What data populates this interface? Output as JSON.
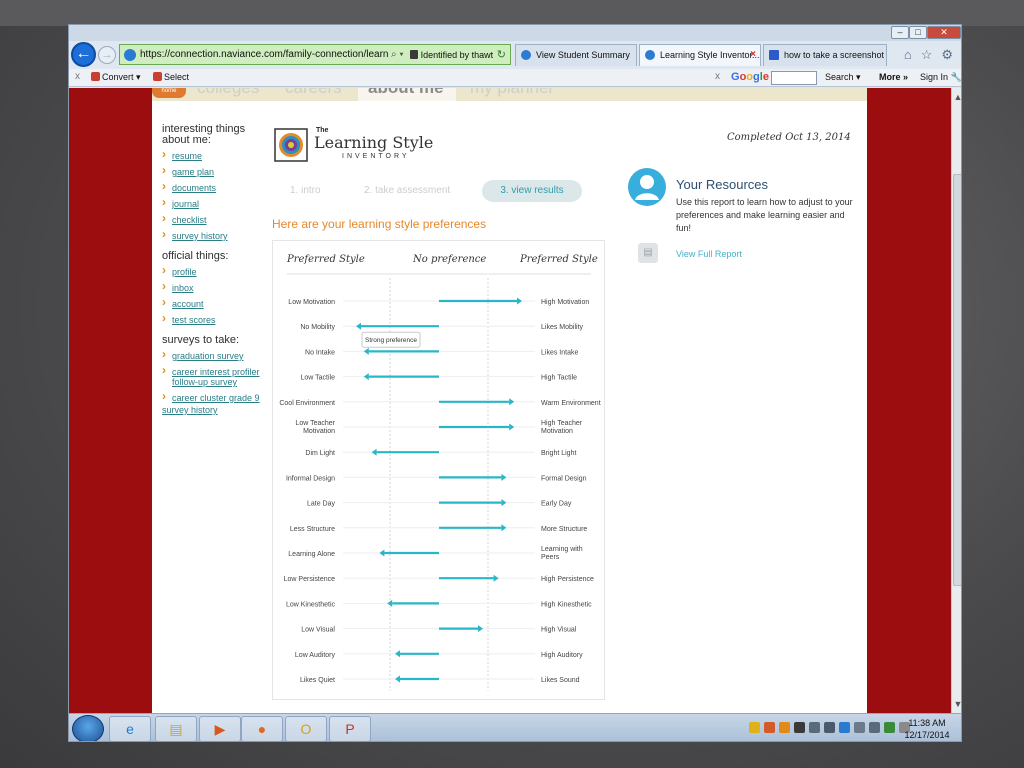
{
  "browser": {
    "address_url": "https://connection.naviance.com/family-connection/learning-styl",
    "address_tail": "⌕ ▾",
    "identified_text": "Identified by thawte",
    "tabs": [
      {
        "label": "View Student Summary"
      },
      {
        "label": "Learning Style Inventor..."
      },
      {
        "label": "how to take a screenshot -..."
      }
    ],
    "command_bar": {
      "convert_label": "Convert",
      "select_label": "Select",
      "google_logo": [
        "G",
        "o",
        "o",
        "g",
        "l",
        "e"
      ],
      "search_label": "Search",
      "more_label": "More »",
      "signin_label": "Sign In"
    }
  },
  "site_nav": {
    "home_label": "home",
    "tabs": [
      "colleges",
      "careers",
      "about me",
      "my planner"
    ]
  },
  "sidebar": {
    "sections": [
      {
        "heading": "interesting things about me:",
        "links": [
          "resume",
          "game plan",
          "documents",
          "journal",
          "checklist",
          "survey history"
        ]
      },
      {
        "heading": "official things:",
        "links": [
          "profile",
          "inbox",
          "account",
          "test scores"
        ]
      },
      {
        "heading": "surveys to take:",
        "links": [
          "graduation survey",
          "career interest profiler follow-up survey",
          "career cluster grade 9"
        ]
      }
    ],
    "extra_link": "survey history"
  },
  "logo": {
    "the": "The",
    "title": "Learning Style",
    "subtitle": "INVENTORY"
  },
  "steps": [
    "1. intro",
    "2. take assessment",
    "3. view results"
  ],
  "heading": "Here are your learning style preferences",
  "chart_data": {
    "type": "bar",
    "headers": {
      "left": "Preferred Style",
      "center": "No preference",
      "right": "Preferred Style"
    },
    "tooltip": "Strong preference",
    "scale_note": "value: negative = toward left trait, positive = toward right trait; range -1 to 1",
    "xlim": [
      -1,
      1
    ],
    "rows": [
      {
        "left": "Low Motivation",
        "right": "High Motivation",
        "value": 1.0
      },
      {
        "left": "No Mobility",
        "right": "Likes Mobility",
        "value": -1.0
      },
      {
        "left": "No Intake",
        "right": "Likes Intake",
        "value": -0.9
      },
      {
        "left": "Low Tactile",
        "right": "High Tactile",
        "value": -0.9
      },
      {
        "left": "Cool Environment",
        "right": "Warm Environment",
        "value": 0.9
      },
      {
        "left": "Low Teacher Motivation",
        "right": "High Teacher Motivation",
        "value": 0.9
      },
      {
        "left": "Dim Light",
        "right": "Bright Light",
        "value": -0.8
      },
      {
        "left": "Informal Design",
        "right": "Formal Design",
        "value": 0.8
      },
      {
        "left": "Late Day",
        "right": "Early Day",
        "value": 0.8
      },
      {
        "left": "Less Structure",
        "right": "More Structure",
        "value": 0.8
      },
      {
        "left": "Learning Alone",
        "right": "Learning with Peers",
        "value": -0.7
      },
      {
        "left": "Low Persistence",
        "right": "High Persistence",
        "value": 0.7
      },
      {
        "left": "Low Kinesthetic",
        "right": "High Kinesthetic",
        "value": -0.6
      },
      {
        "left": "Low Visual",
        "right": "High Visual",
        "value": 0.5
      },
      {
        "left": "Low Auditory",
        "right": "High Auditory",
        "value": -0.5
      },
      {
        "left": "Likes Quiet",
        "right": "Likes Sound",
        "value": -0.5
      }
    ],
    "bar_color": "#29b6c8"
  },
  "resources": {
    "completed": "Completed Oct 13, 2014",
    "title": "Your Resources",
    "body": "Use this report to learn how to adjust to your preferences and make learning easier and fun!",
    "report_link": "View Full Report"
  },
  "taskbar": {
    "time": "11:38 AM",
    "date": "12/17/2014"
  },
  "colors": {
    "frame_red": "#9c0d0f",
    "accent_orange": "#e8882a",
    "link_teal": "#2a7e87"
  }
}
